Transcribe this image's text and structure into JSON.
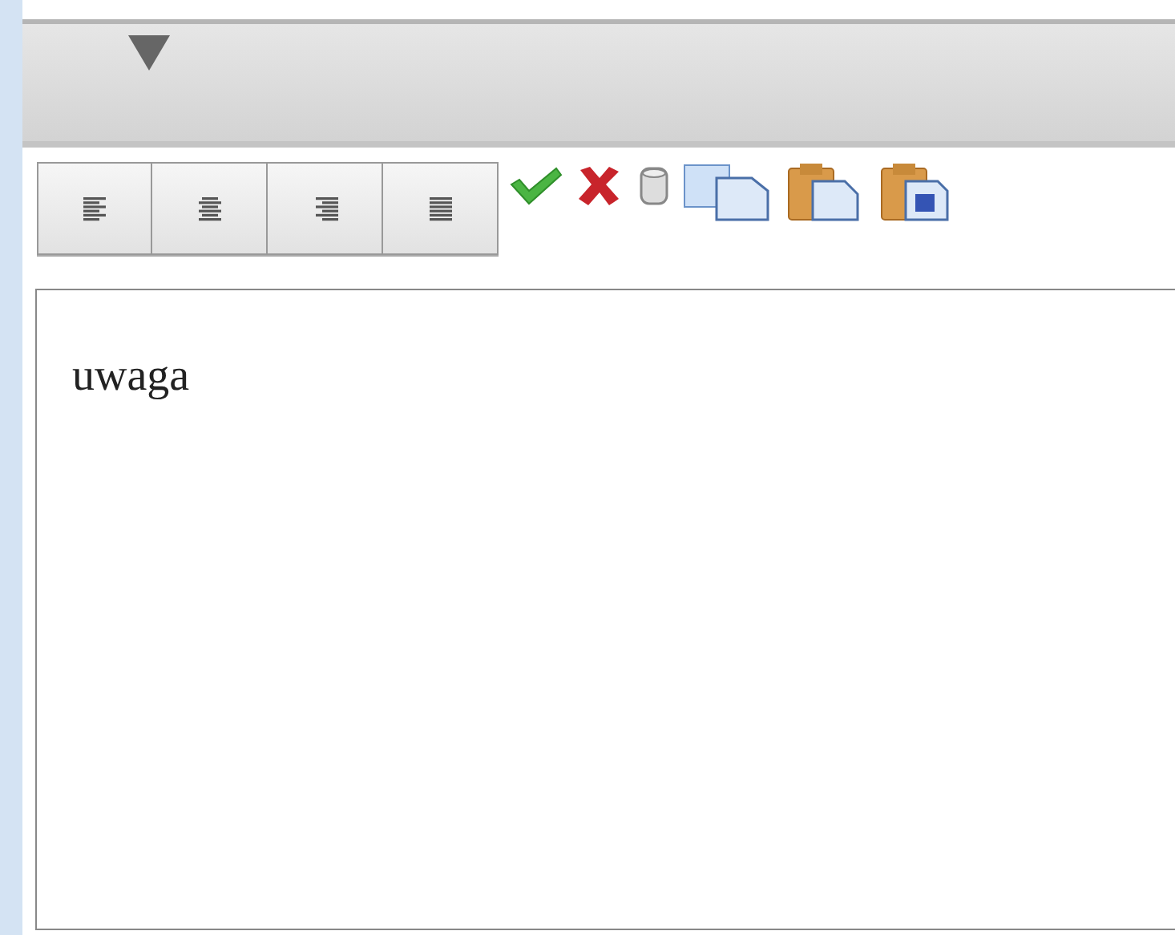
{
  "toolbar": {
    "align_buttons": [
      {
        "kind": "left"
      },
      {
        "kind": "center"
      },
      {
        "kind": "right"
      },
      {
        "kind": "justify"
      }
    ],
    "tools": [
      {
        "kind": "accept"
      },
      {
        "kind": "cancel"
      },
      {
        "kind": "delete"
      },
      {
        "kind": "copy"
      },
      {
        "kind": "paste"
      },
      {
        "kind": "paste-special"
      }
    ]
  },
  "editor": {
    "value": "uwaga"
  }
}
